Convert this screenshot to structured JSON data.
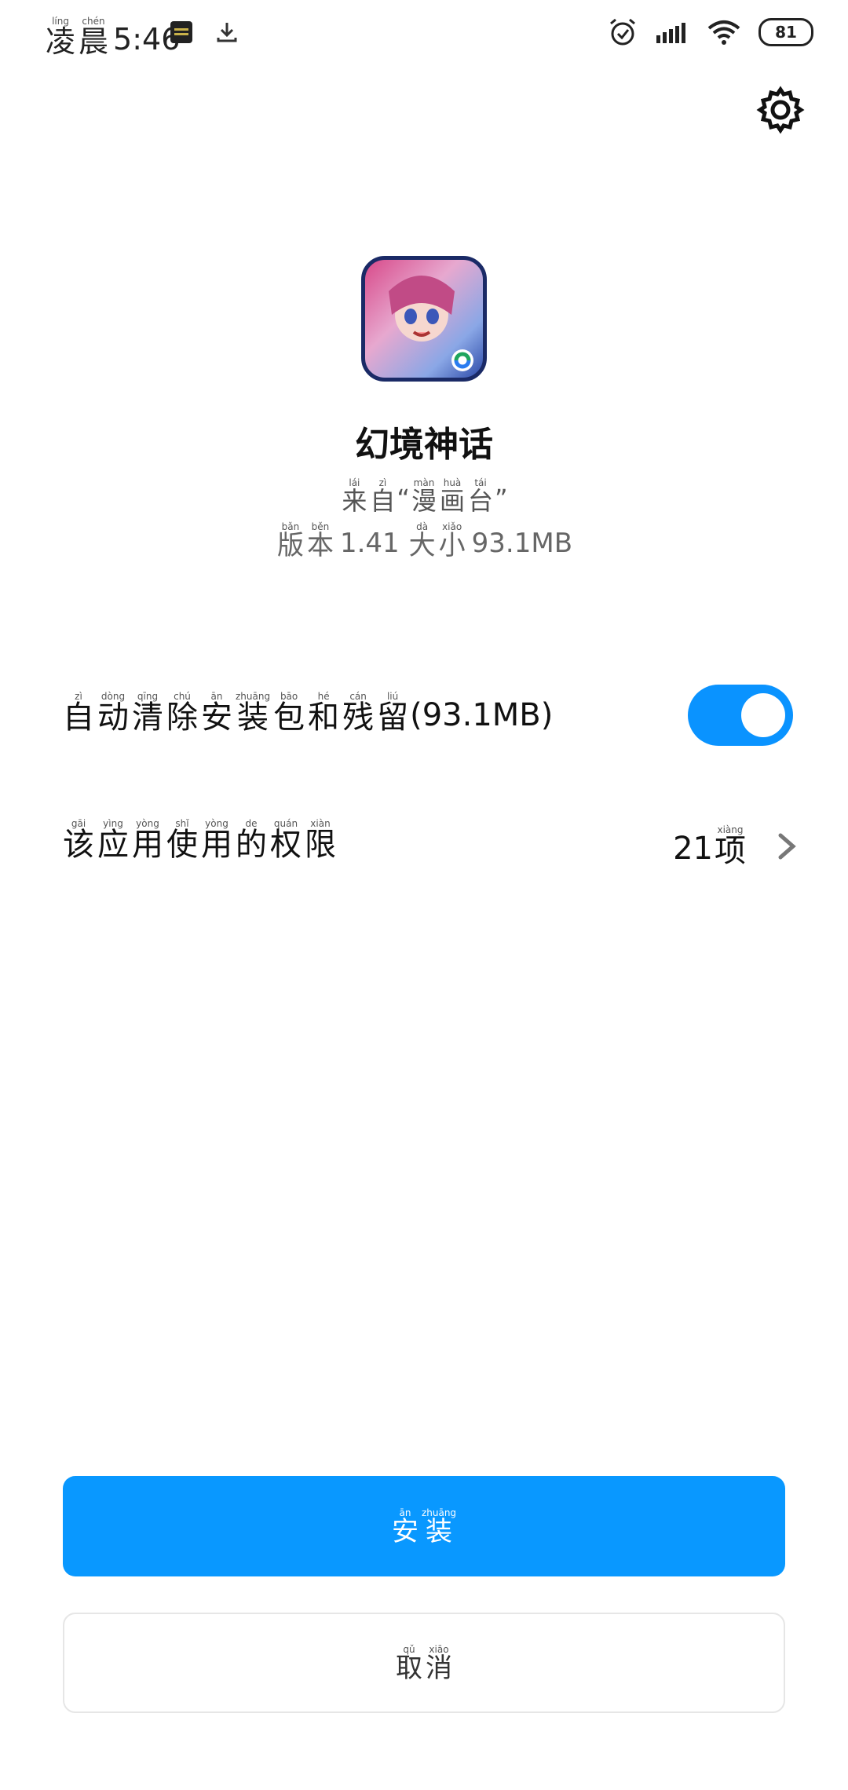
{
  "status_bar": {
    "time_prefix_chars": [
      {
        "han": "凌",
        "pinyin": "líng"
      },
      {
        "han": "晨",
        "pinyin": "chén"
      }
    ],
    "time": "5:46",
    "battery": "81",
    "icons": [
      "app-notification-icon",
      "download-icon",
      "alarm-icon",
      "signal-icon",
      "wifi-icon",
      "battery-icon"
    ]
  },
  "app": {
    "name": "幻境神话",
    "source_prefix": [
      {
        "han": "来",
        "pinyin": "lái"
      },
      {
        "han": "自",
        "pinyin": "zì"
      }
    ],
    "source_quote_open": "“",
    "source_name_chars": [
      {
        "han": "漫",
        "pinyin": "màn"
      },
      {
        "han": "画",
        "pinyin": "huà"
      },
      {
        "han": "台",
        "pinyin": "tái"
      }
    ],
    "source_quote_close": "”",
    "version_label_chars": [
      {
        "han": "版",
        "pinyin": "bǎn"
      },
      {
        "han": "本",
        "pinyin": "běn"
      }
    ],
    "version": "1.41",
    "size_label_chars": [
      {
        "han": "大",
        "pinyin": "dà"
      },
      {
        "han": "小",
        "pinyin": "xiǎo"
      }
    ],
    "size": "93.1MB"
  },
  "auto_clean": {
    "label_chars": [
      {
        "han": "自",
        "pinyin": "zì"
      },
      {
        "han": "动",
        "pinyin": "dòng"
      },
      {
        "han": "清",
        "pinyin": "qīng"
      },
      {
        "han": "除",
        "pinyin": "chú"
      },
      {
        "han": "安",
        "pinyin": "ān"
      },
      {
        "han": "装",
        "pinyin": "zhuāng"
      },
      {
        "han": "包",
        "pinyin": "bāo"
      },
      {
        "han": "和",
        "pinyin": "hé"
      },
      {
        "han": "残",
        "pinyin": "cán"
      },
      {
        "han": "留",
        "pinyin": "liú"
      }
    ],
    "size_suffix": "(93.1MB)",
    "enabled": true
  },
  "permissions": {
    "label_chars": [
      {
        "han": "该",
        "pinyin": "gāi"
      },
      {
        "han": "应",
        "pinyin": "yìng"
      },
      {
        "han": "用",
        "pinyin": "yòng"
      },
      {
        "han": "使",
        "pinyin": "shǐ"
      },
      {
        "han": "用",
        "pinyin": "yòng"
      },
      {
        "han": "的",
        "pinyin": "de"
      },
      {
        "han": "权",
        "pinyin": "quán"
      },
      {
        "han": "限",
        "pinyin": "xiàn"
      }
    ],
    "count": "21",
    "count_unit": {
      "han": "项",
      "pinyin": "xiàng"
    }
  },
  "buttons": {
    "install_chars": [
      {
        "han": "安",
        "pinyin": "ān"
      },
      {
        "han": "装",
        "pinyin": "zhuāng"
      }
    ],
    "cancel_chars": [
      {
        "han": "取",
        "pinyin": "qǔ"
      },
      {
        "han": "消",
        "pinyin": "xiāo"
      }
    ]
  },
  "colors": {
    "accent": "#0998ff",
    "toggle_on": "#0a93ff",
    "text": "#111111",
    "muted": "#666666"
  }
}
